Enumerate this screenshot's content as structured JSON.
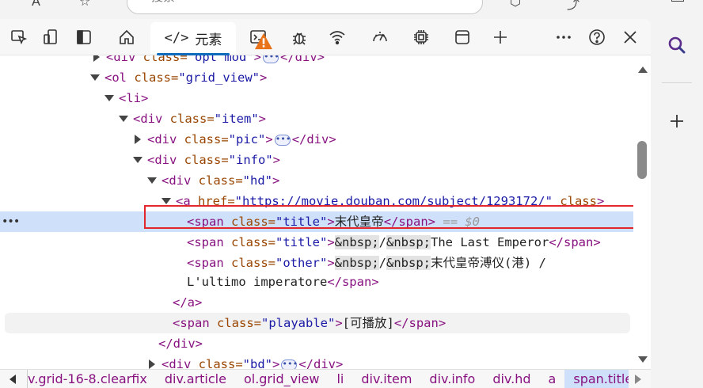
{
  "browser": {
    "address_placeholder": "搜索"
  },
  "devtools": {
    "tabs": {
      "elements": "元素"
    },
    "tree": {
      "lines": [
        {
          "id": "l0",
          "open": "<div class=\"opt mod\">",
          "close": "</div>"
        },
        {
          "id": "l1",
          "text": "<ol class=\"grid_view\">"
        },
        {
          "id": "l2",
          "text": "<li>"
        },
        {
          "id": "l3",
          "text": "<div class=\"item\">"
        },
        {
          "id": "l4",
          "text": "<div class=\"pic\">",
          "close": "</div>"
        },
        {
          "id": "l5",
          "text": "<div class=\"info\">"
        },
        {
          "id": "l6",
          "text": "<div class=\"hd\">"
        },
        {
          "id": "l7",
          "href": "https://movie.douban.com/subject/1293172/"
        }
      ],
      "title_text": "末代皇帝",
      "dollar_zero": "== $0",
      "nbsp": "&nbsp;",
      "slash": "/",
      "title2_text": "The Last Emperor",
      "other_text": "末代皇帝溥仪(港) /",
      "other_text2": "L'ultimo imperatore",
      "playable_text": "[可播放]"
    },
    "breadcrumbs": [
      {
        "label": "v.grid-16-8.clearfix",
        "active": false
      },
      {
        "label": "div.article",
        "active": false
      },
      {
        "label": "ol.grid_view",
        "active": false
      },
      {
        "label": "li",
        "active": false
      },
      {
        "label": "div.item",
        "active": false
      },
      {
        "label": "div.info",
        "active": false
      },
      {
        "label": "div.hd",
        "active": false
      },
      {
        "label": "a",
        "active": false
      },
      {
        "label": "span.title",
        "active": true
      }
    ]
  },
  "colors": {
    "tag": "#881280",
    "attr_name": "#994500",
    "attr_value": "#1a1aa6",
    "selected_row": "#cfe0fb",
    "highlight_box": "#e3262b",
    "accent": "#0f6cbd"
  }
}
